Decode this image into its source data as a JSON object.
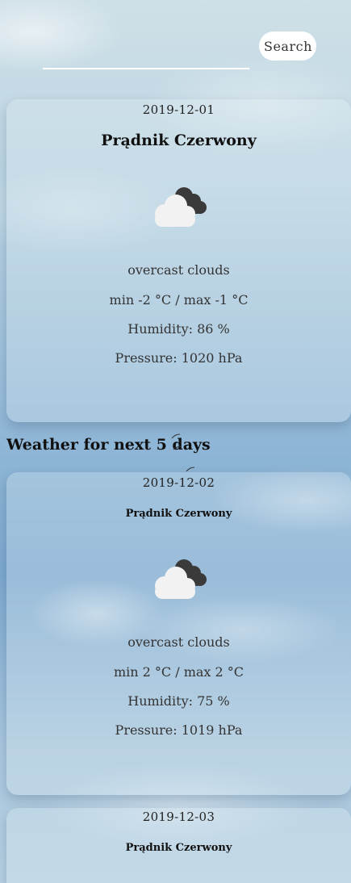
{
  "search": {
    "placeholder": "",
    "button_label": "Search"
  },
  "current": {
    "date": "2019-12-01",
    "city": "Prądnik Czerwony",
    "icon": "overcast-cloud-icon",
    "description": "overcast clouds",
    "temp_range": "min -2 °C / max -1 °C",
    "humidity": "Humidity: 86 %",
    "pressure": "Pressure: 1020 hPa"
  },
  "forecast_title": "Weather for next 5 days",
  "forecast": [
    {
      "date": "2019-12-02",
      "city": "Prądnik Czerwony",
      "icon": "overcast-cloud-icon",
      "description": "overcast clouds",
      "temp_range": "min 2 °C / max 2 °C",
      "humidity": "Humidity: 75 %",
      "pressure": "Pressure: 1019 hPa"
    },
    {
      "date": "2019-12-03",
      "city": "Prądnik Czerwony"
    }
  ],
  "colors": {
    "card_bg": "rgba(230,240,246,0.28)",
    "search_button_bg": "#ffffff",
    "icon_cloud_light": "#f2f2f2",
    "icon_cloud_dark": "#3a3a3a"
  }
}
